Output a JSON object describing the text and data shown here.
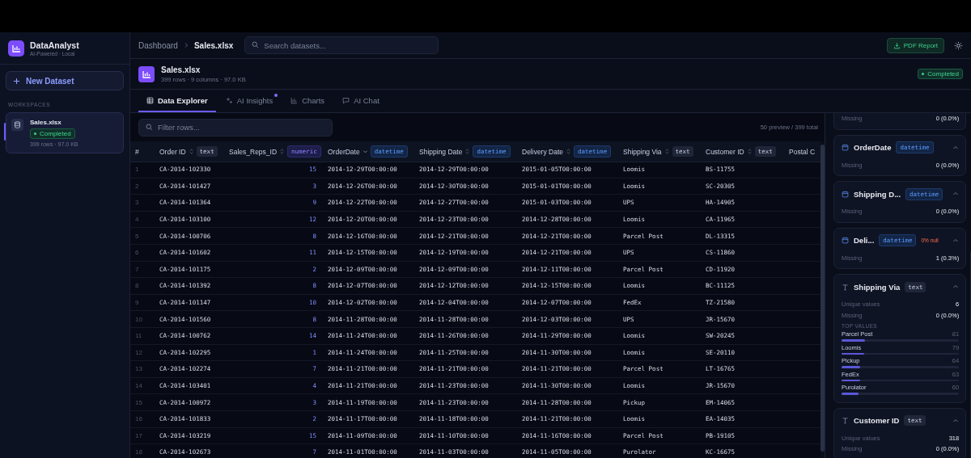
{
  "app": {
    "name": "DataAnalyst",
    "subtitle": "AI-Powered · Local"
  },
  "sidebar": {
    "new_button": "New Dataset",
    "section": "WORKSPACES",
    "items": [
      {
        "name": "Sales.xlsx",
        "status": "Completed",
        "meta": "399 rows · 97.0 KB",
        "selected": true
      }
    ]
  },
  "topbar": {
    "breadcrumb": [
      "Dashboard",
      "Sales.xlsx"
    ],
    "search_placeholder": "Search datasets...",
    "report_button": "PDF Report"
  },
  "dataset": {
    "name": "Sales.xlsx",
    "meta": "399 rows · 9 columns · 97.0 KB",
    "status": "Completed"
  },
  "tabs": [
    {
      "label": "Data Explorer",
      "selected": true,
      "dot": false
    },
    {
      "label": "AI Insights",
      "selected": false,
      "dot": true
    },
    {
      "label": "Charts",
      "selected": false,
      "dot": false
    },
    {
      "label": "AI Chat",
      "selected": false,
      "dot": false
    }
  ],
  "filter": {
    "placeholder": "Filter rows...",
    "count": "50 preview / 399 total"
  },
  "table": {
    "columns": [
      {
        "label": "#"
      },
      {
        "label": "Order ID",
        "type": "text",
        "kind": "text",
        "sorted": false
      },
      {
        "label": "Sales_Reps_ID",
        "type": "numeric",
        "kind": "numeric",
        "sorted": false
      },
      {
        "label": "OrderDate",
        "type": "datetime",
        "kind": "datetime",
        "sorted": true
      },
      {
        "label": "Shipping Date",
        "type": "datetime",
        "kind": "datetime",
        "sorted": false
      },
      {
        "label": "Delivery Date",
        "type": "datetime",
        "kind": "datetime",
        "sorted": false
      },
      {
        "label": "Shipping Via",
        "type": "text",
        "kind": "text",
        "sorted": false
      },
      {
        "label": "Customer ID",
        "type": "text",
        "kind": "text",
        "sorted": false
      },
      {
        "label": "Postal C"
      }
    ],
    "rows": [
      [
        "1",
        "CA-2014-102330",
        "15",
        "2014-12-29T00:00:00",
        "2014-12-29T00:00:00",
        "2015-01-05T00:00:00",
        "Loomis",
        "BS-11755"
      ],
      [
        "2",
        "CA-2014-101427",
        "3",
        "2014-12-26T00:00:00",
        "2014-12-30T00:00:00",
        "2015-01-01T00:00:00",
        "Loomis",
        "SC-20305"
      ],
      [
        "3",
        "CA-2014-101364",
        "9",
        "2014-12-22T00:00:00",
        "2014-12-27T00:00:00",
        "2015-01-03T00:00:00",
        "UPS",
        "HA-14905"
      ],
      [
        "4",
        "CA-2014-103100",
        "12",
        "2014-12-20T00:00:00",
        "2014-12-23T00:00:00",
        "2014-12-28T00:00:00",
        "Loomis",
        "CA-11965"
      ],
      [
        "5",
        "CA-2014-100706",
        "8",
        "2014-12-16T00:00:00",
        "2014-12-21T00:00:00",
        "2014-12-21T00:00:00",
        "Parcel Post",
        "DL-13315"
      ],
      [
        "6",
        "CA-2014-101602",
        "11",
        "2014-12-15T00:00:00",
        "2014-12-19T00:00:00",
        "2014-12-21T00:00:00",
        "UPS",
        "CS-11860"
      ],
      [
        "7",
        "CA-2014-101175",
        "2",
        "2014-12-09T00:00:00",
        "2014-12-09T00:00:00",
        "2014-12-11T00:00:00",
        "Parcel Post",
        "CD-11920"
      ],
      [
        "8",
        "CA-2014-101392",
        "8",
        "2014-12-07T00:00:00",
        "2014-12-12T00:00:00",
        "2014-12-15T00:00:00",
        "Loomis",
        "BC-11125"
      ],
      [
        "9",
        "CA-2014-101147",
        "10",
        "2014-12-02T00:00:00",
        "2014-12-04T00:00:00",
        "2014-12-07T00:00:00",
        "FedEx",
        "TZ-21580"
      ],
      [
        "10",
        "CA-2014-101560",
        "8",
        "2014-11-28T00:00:00",
        "2014-11-28T00:00:00",
        "2014-12-03T00:00:00",
        "UPS",
        "JR-15670"
      ],
      [
        "11",
        "CA-2014-100762",
        "14",
        "2014-11-24T00:00:00",
        "2014-11-26T00:00:00",
        "2014-11-29T00:00:00",
        "Loomis",
        "SW-20245"
      ],
      [
        "12",
        "CA-2014-102295",
        "1",
        "2014-11-24T00:00:00",
        "2014-11-25T00:00:00",
        "2014-11-30T00:00:00",
        "Loomis",
        "SE-20110"
      ],
      [
        "13",
        "CA-2014-102274",
        "7",
        "2014-11-21T00:00:00",
        "2014-11-21T00:00:00",
        "2014-11-21T00:00:00",
        "Parcel Post",
        "LT-16765"
      ],
      [
        "14",
        "CA-2014-103401",
        "4",
        "2014-11-21T00:00:00",
        "2014-11-23T00:00:00",
        "2014-11-30T00:00:00",
        "Loomis",
        "JR-15670"
      ],
      [
        "15",
        "CA-2014-100972",
        "3",
        "2014-11-19T00:00:00",
        "2014-11-23T00:00:00",
        "2014-11-28T00:00:00",
        "Pickup",
        "EM-14065"
      ],
      [
        "16",
        "CA-2014-101833",
        "2",
        "2014-11-17T00:00:00",
        "2014-11-18T00:00:00",
        "2014-11-21T00:00:00",
        "Loomis",
        "EA-14035"
      ],
      [
        "17",
        "CA-2014-103219",
        "15",
        "2014-11-09T00:00:00",
        "2014-11-10T00:00:00",
        "2014-11-16T00:00:00",
        "Parcel Post",
        "PB-19105"
      ],
      [
        "18",
        "CA-2014-102673",
        "7",
        "2014-11-01T00:00:00",
        "2014-11-03T00:00:00",
        "2014-11-05T00:00:00",
        "Purolator",
        "KC-16675"
      ]
    ]
  },
  "profile_cards": [
    {
      "stats": [
        {
          "label": "Missing",
          "value": "0 (0.0%)"
        }
      ]
    },
    {
      "name": "OrderDate",
      "type": "datetime",
      "kind": "datetime",
      "expanded": true,
      "stats": [
        {
          "label": "Missing",
          "value": "0 (0.0%)"
        }
      ]
    },
    {
      "name": "Shipping D...",
      "type": "datetime",
      "kind": "datetime",
      "expanded": true,
      "stats": [
        {
          "label": "Missing",
          "value": "0 (0.0%)"
        }
      ]
    },
    {
      "name": "Deli...",
      "type": "datetime",
      "kind": "datetime",
      "null_note": "0% null",
      "expanded": true,
      "stats": [
        {
          "label": "Missing",
          "value": "1 (0.3%)"
        }
      ]
    },
    {
      "name": "Shipping Via",
      "type": "text",
      "kind": "text",
      "expanded": true,
      "stats": [
        {
          "label": "Unique values",
          "value": "6"
        },
        {
          "label": "Missing",
          "value": "0 (0.0%)"
        }
      ],
      "top_label": "TOP VALUES",
      "top_values": [
        {
          "label": "Parcel Post",
          "count": "81",
          "level": 0.2
        },
        {
          "label": "Loomis",
          "count": "79",
          "level": 0.195
        },
        {
          "label": "Pickup",
          "count": "64",
          "level": 0.158
        },
        {
          "label": "FedEx",
          "count": "63",
          "level": 0.155
        },
        {
          "label": "Purolator",
          "count": "60",
          "level": 0.148
        }
      ]
    },
    {
      "name": "Customer ID",
      "type": "text",
      "kind": "text",
      "expanded": true,
      "stats": [
        {
          "label": "Unique values",
          "value": "318"
        },
        {
          "label": "Missing",
          "value": "0 (0.0%)"
        }
      ]
    }
  ]
}
